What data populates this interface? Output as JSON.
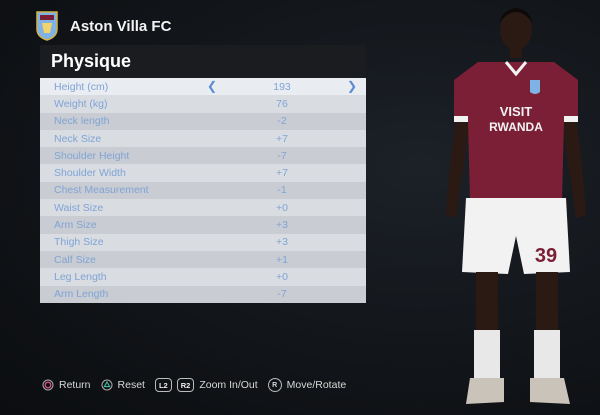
{
  "header": {
    "club_name": "Aston Villa FC"
  },
  "panel": {
    "title": "Physique",
    "rows": [
      {
        "label": "Height (cm)",
        "value": "193"
      },
      {
        "label": "Weight (kg)",
        "value": "76"
      },
      {
        "label": "Neck length",
        "value": "-2"
      },
      {
        "label": "Neck Size",
        "value": "+7"
      },
      {
        "label": "Shoulder Height",
        "value": "-7"
      },
      {
        "label": "Shoulder Width",
        "value": "+7"
      },
      {
        "label": "Chest Measurement",
        "value": "-1"
      },
      {
        "label": "Waist Size",
        "value": "+0"
      },
      {
        "label": "Arm Size",
        "value": "+3"
      },
      {
        "label": "Thigh Size",
        "value": "+3"
      },
      {
        "label": "Calf Size",
        "value": "+1"
      },
      {
        "label": "Leg Length",
        "value": "+0"
      },
      {
        "label": "Arm Length",
        "value": "-7"
      }
    ]
  },
  "player": {
    "shirt_sponsor_line1": "VISIT",
    "shirt_sponsor_line2": "RWANDA",
    "shorts_number": "39"
  },
  "footer": {
    "return_label": "Return",
    "reset_label": "Reset",
    "l2_key": "L2",
    "r2_key": "R2",
    "zoom_label": "Zoom In/Out",
    "r_key": "R",
    "move_label": "Move/Rotate"
  },
  "colors": {
    "accent": "#5a8dd6",
    "shirt": "#7a1f35",
    "shorts": "#f2f2f2"
  }
}
